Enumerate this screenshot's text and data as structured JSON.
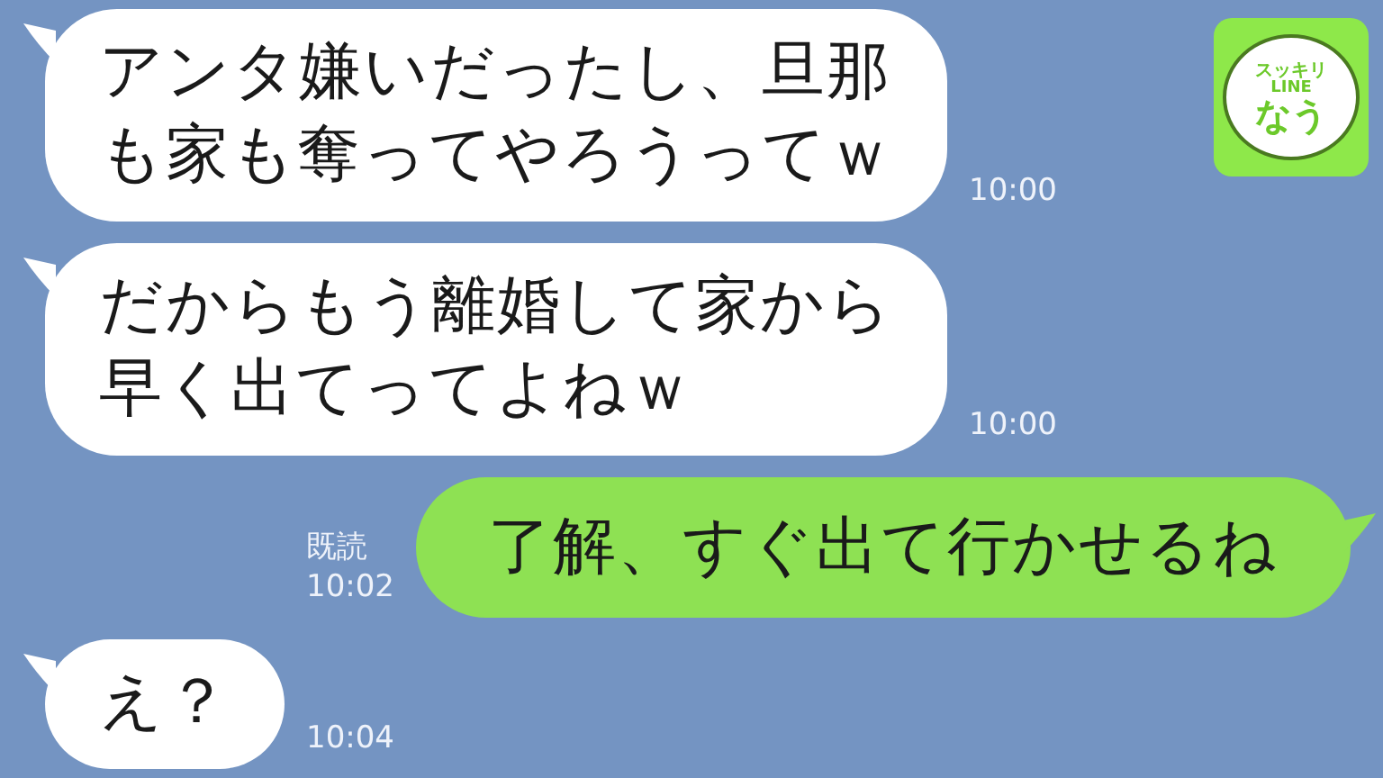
{
  "logo": {
    "top": "スッキリ",
    "middle": "LINE",
    "bottom": "なう"
  },
  "messages": [
    {
      "kind": "received",
      "lines": [
        "アンタ嫌いだったし、旦那",
        "も家も奪ってやろうってｗ"
      ],
      "time": "10:00"
    },
    {
      "kind": "received",
      "lines": [
        "だからもう離婚して家から",
        "早く出てってよねｗ"
      ],
      "time": "10:00"
    },
    {
      "kind": "sent",
      "lines": [
        "了解、すぐ出て行かせるね"
      ],
      "read": "既読",
      "time": "10:02"
    },
    {
      "kind": "received",
      "lines": [
        "え？"
      ],
      "time": "10:04"
    }
  ]
}
